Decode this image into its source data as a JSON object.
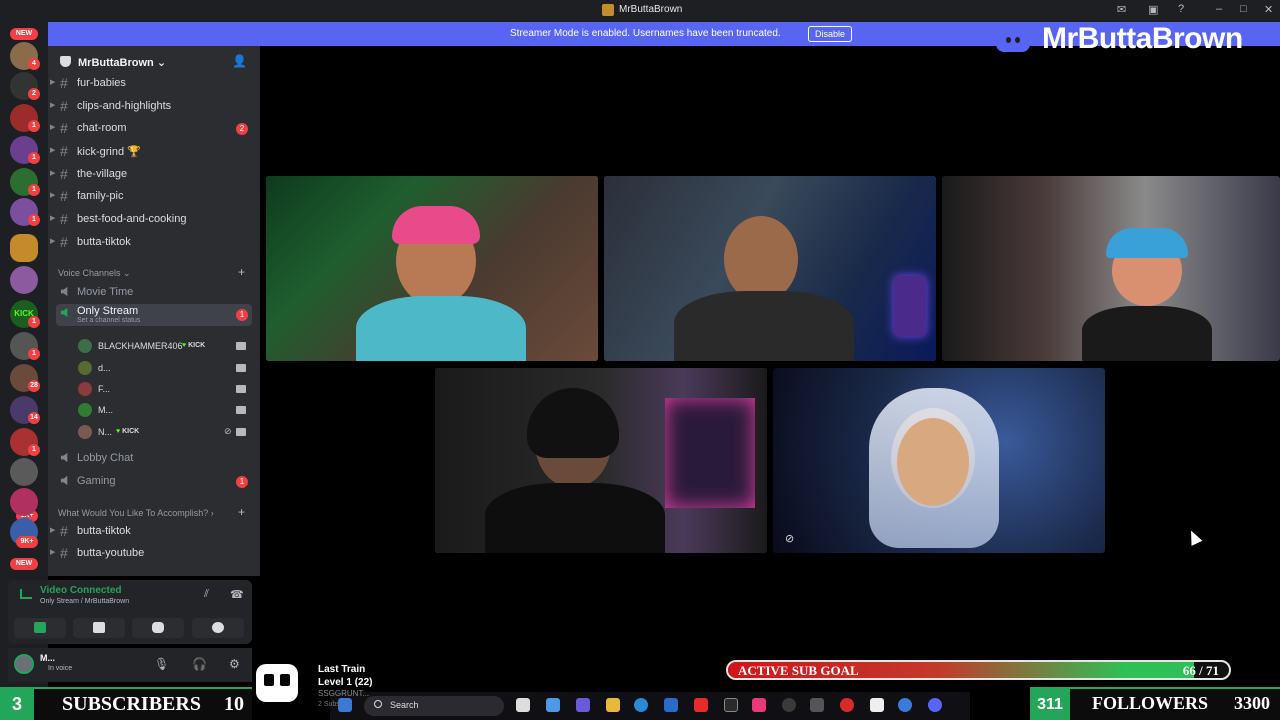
{
  "window": {
    "title": "MrButtaBrown"
  },
  "banner": {
    "text": "Streamer Mode is enabled. Usernames have been truncated.",
    "button": "Disable"
  },
  "brand": {
    "name": "MrButtaBrown"
  },
  "rail": {
    "badges": [
      "NEW",
      "4",
      "2",
      "1",
      "1",
      "1",
      "1",
      "1",
      "1",
      "1",
      "1",
      "1",
      "28",
      "14",
      "1",
      "1K+",
      "9K+",
      "NEW"
    ]
  },
  "server": {
    "name": "MrButtaBrown"
  },
  "text_channels": [
    {
      "name": "fur-babies"
    },
    {
      "name": "clips-and-highlights"
    },
    {
      "name": "chat-room",
      "badge": "2"
    },
    {
      "name": "kick-grind 🏆"
    },
    {
      "name": "the-village"
    },
    {
      "name": "family-pic"
    },
    {
      "name": "best-food-and-cooking"
    },
    {
      "name": "butta-tiktok"
    }
  ],
  "voice_category": "Voice Channels",
  "voice_channels": {
    "movie_time": "Movie Time",
    "only_stream": {
      "name": "Only Stream",
      "status": "Set a channel status",
      "badge": "1"
    },
    "lobby_chat": "Lobby Chat",
    "gaming": {
      "name": "Gaming",
      "badge": "1"
    }
  },
  "members": [
    {
      "name": "BLACKHAMMER406",
      "kick": "KICK"
    },
    {
      "name": "d..."
    },
    {
      "name": "F..."
    },
    {
      "name": "M..."
    },
    {
      "name": "N...",
      "kick": "KICK"
    }
  ],
  "category2": {
    "name": "What Would You Like To Accomplish?"
  },
  "bottom_channels": [
    "butta-tiktok",
    "butta-youtube"
  ],
  "voice_panel": {
    "title": "Video Connected",
    "subtitle": "Only Stream / MrButtaBrown"
  },
  "user": {
    "name": "M...",
    "status": "In voice"
  },
  "overlays": {
    "subs_count": "3",
    "subs_label": "SUBSCRIBERS",
    "subs_goal": "10",
    "song_title": "Last Train",
    "song_level": "Level 1  (22)",
    "song_user": "SSGGRUNT...",
    "song_subs": "2 Subs",
    "subgoal_label": "ACTIVE SUB GOAL",
    "subgoal_value": "66 / 71",
    "subgoal_progress": 0.93,
    "followers_count": "311",
    "followers_label": "FOLLOWERS",
    "followers_goal": "3300"
  },
  "taskbar": {
    "search": "Search"
  },
  "colors": {
    "accent": "#5865f2",
    "speaking": "#23a55a",
    "sidebar": "#2b2d31",
    "rail": "#1e1f22"
  }
}
